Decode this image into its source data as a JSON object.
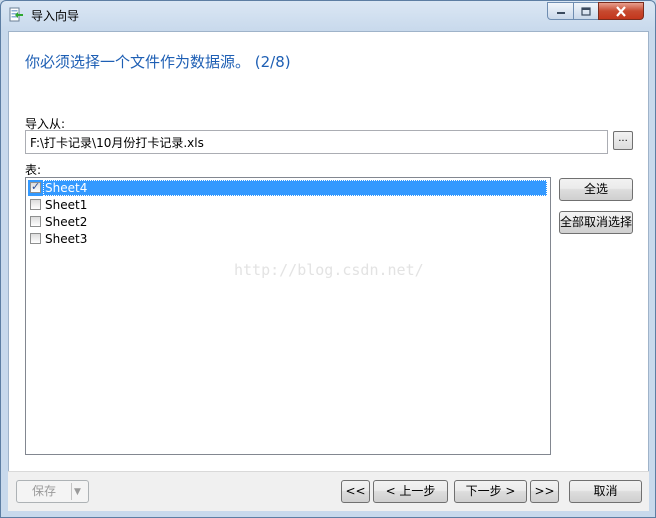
{
  "window": {
    "title": "导入向导",
    "icons": {
      "app": "import-wizard-icon",
      "minimize": "minimize-icon",
      "maximize": "maximize-icon",
      "close": "close-icon"
    }
  },
  "heading": "你必须选择一个文件作为数据源。 (2/8)",
  "import_from": {
    "label": "导入从:",
    "value": "F:\\打卡记录\\10月份打卡记录.xls",
    "browse_label": "..."
  },
  "tables": {
    "label": "表:",
    "items": [
      {
        "label": "Sheet4",
        "checked": true,
        "selected": true
      },
      {
        "label": "Sheet1",
        "checked": false,
        "selected": false
      },
      {
        "label": "Sheet2",
        "checked": false,
        "selected": false
      },
      {
        "label": "Sheet3",
        "checked": false,
        "selected": false
      }
    ]
  },
  "side_buttons": {
    "select_all": "全选",
    "deselect_all": "全部取消选择"
  },
  "watermark": "http://blog.csdn.net/",
  "footer": {
    "save": "保存",
    "first": "<<",
    "prev": "< 上一步",
    "next": "下一步 >",
    "last": ">>",
    "cancel": "取消"
  },
  "colors": {
    "heading": "#1e5fb4",
    "selection": "#3399ff",
    "frame": "#c8d9ec"
  }
}
